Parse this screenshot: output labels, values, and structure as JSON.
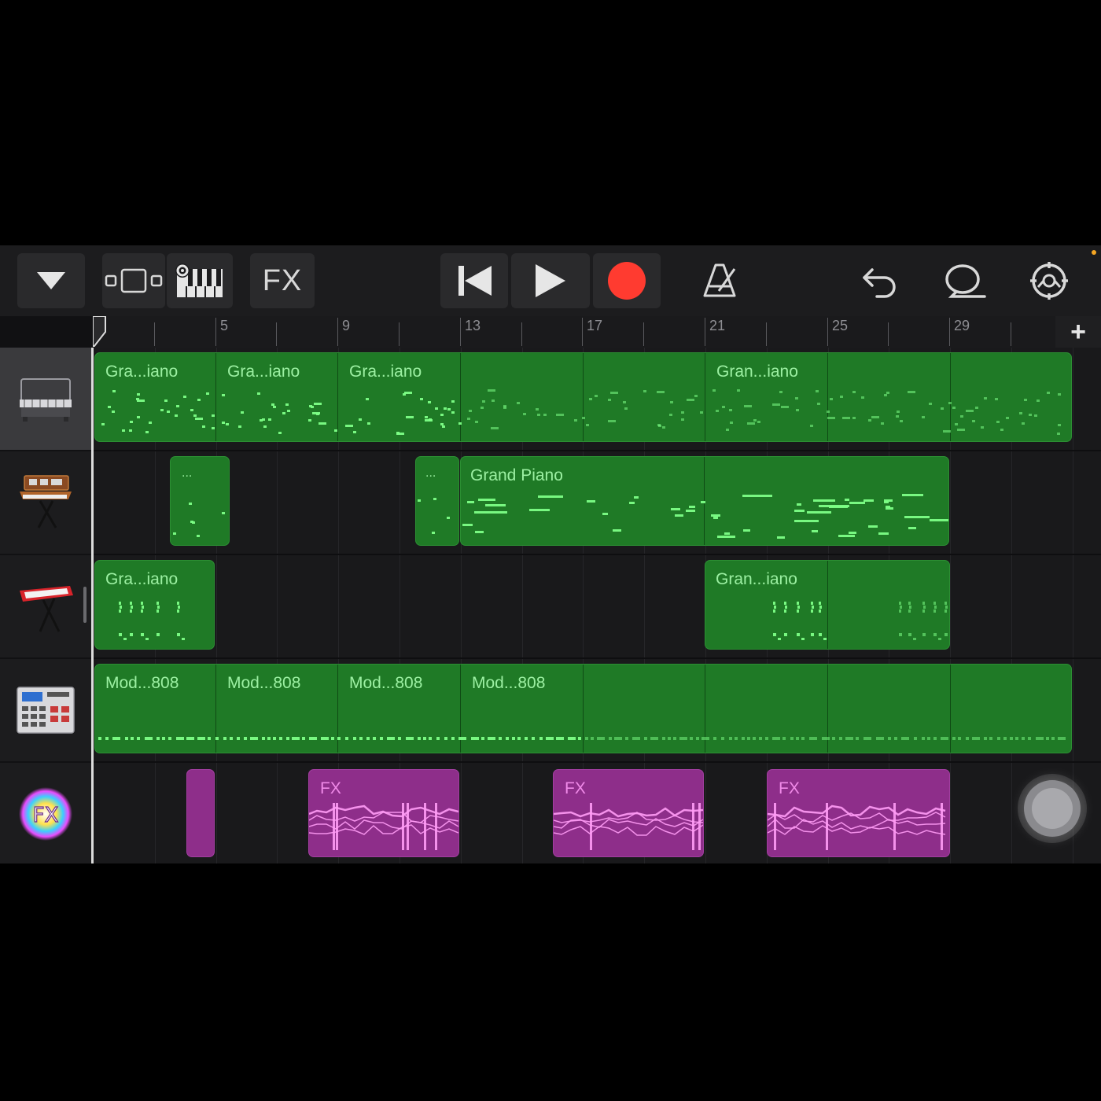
{
  "toolbar": {
    "fx_label": "FX",
    "icons": [
      "tracks-menu-icon",
      "view-toggle-icon",
      "keyboard-settings-icon",
      "rewind-icon",
      "play-icon",
      "record-icon",
      "metronome-icon",
      "undo-icon",
      "loop-icon",
      "settings-icon"
    ],
    "record_color": "#ff3b30"
  },
  "ruler": {
    "bar_numbers": [
      "5",
      "9",
      "13",
      "17",
      "21",
      "25",
      "29"
    ],
    "add_label": "+"
  },
  "tracks": [
    {
      "name": "grand-piano-track",
      "icon": "piano-icon",
      "regions": [
        {
          "label": "Gra...iano",
          "color": "green"
        },
        {
          "label": "Gra...iano",
          "color": "green"
        },
        {
          "label": "Gra...iano",
          "color": "green"
        },
        {
          "label": "Gran...iano",
          "color": "green"
        }
      ]
    },
    {
      "name": "synth-track",
      "icon": "synth-keyboard-icon",
      "regions": [
        {
          "label": "...",
          "color": "green"
        },
        {
          "label": "...",
          "color": "green"
        },
        {
          "label": "Grand Piano",
          "color": "green"
        }
      ]
    },
    {
      "name": "red-keyboard-track",
      "icon": "red-keyboard-icon",
      "regions": [
        {
          "label": "Gra...iano",
          "color": "green"
        },
        {
          "label": "Gran...iano",
          "color": "green"
        }
      ]
    },
    {
      "name": "drum-machine-track",
      "icon": "drum-machine-icon",
      "regions": [
        {
          "label": "Mod...808",
          "color": "green"
        },
        {
          "label": "Mod...808",
          "color": "green"
        },
        {
          "label": "Mod...808",
          "color": "green"
        },
        {
          "label": "Mod...808",
          "color": "green"
        }
      ]
    },
    {
      "name": "fx-track",
      "icon": "fx-icon",
      "icon_text": "FX",
      "regions": [
        {
          "label": "",
          "color": "purple"
        },
        {
          "label": "FX",
          "color": "purple"
        },
        {
          "label": "FX",
          "color": "purple"
        },
        {
          "label": "FX",
          "color": "purple"
        }
      ]
    }
  ],
  "colors": {
    "region_green": "#1f7a26",
    "note_green": "#7dff86",
    "region_purple": "#8e2e8a",
    "automation_pink": "#ff9cf5"
  }
}
